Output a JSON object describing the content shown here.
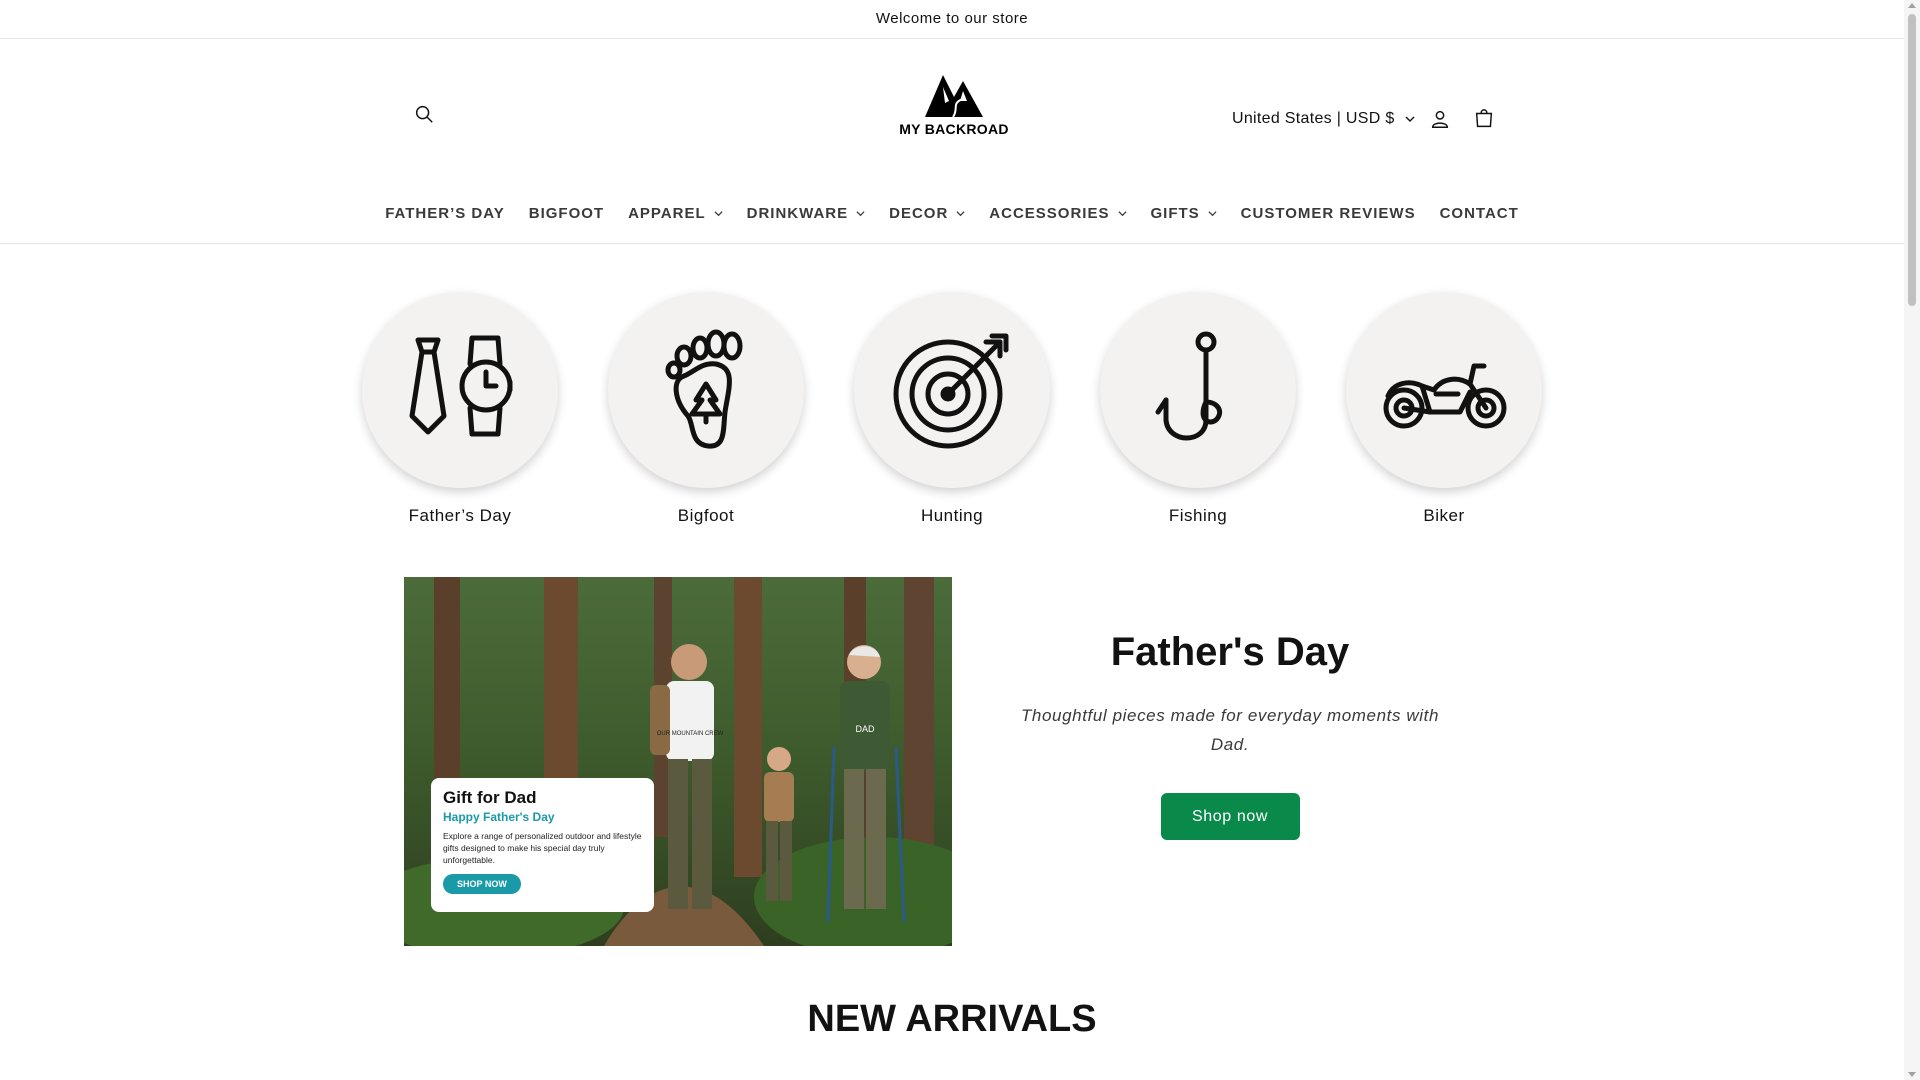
{
  "announcement": "Welcome to our store",
  "header": {
    "brand": "MY BACKROAD",
    "locale": "United States | USD $",
    "icons": {
      "search": "search-icon",
      "account": "account-icon",
      "cart": "cart-icon"
    }
  },
  "nav": [
    {
      "label": "FATHER’S DAY",
      "dropdown": false
    },
    {
      "label": "BIGFOOT",
      "dropdown": false
    },
    {
      "label": "APPAREL",
      "dropdown": true
    },
    {
      "label": "DRINKWARE",
      "dropdown": true
    },
    {
      "label": "DECOR",
      "dropdown": true
    },
    {
      "label": "ACCESSORIES",
      "dropdown": true
    },
    {
      "label": "GIFTS",
      "dropdown": true
    },
    {
      "label": "CUSTOMER REVIEWS",
      "dropdown": false
    },
    {
      "label": "CONTACT",
      "dropdown": false
    }
  ],
  "categories": [
    {
      "label": "Father’s Day",
      "icon": "tie-watch-icon"
    },
    {
      "label": "Bigfoot",
      "icon": "footprint-icon"
    },
    {
      "label": "Hunting",
      "icon": "target-icon"
    },
    {
      "label": "Fishing",
      "icon": "fishhook-icon"
    },
    {
      "label": "Biker",
      "icon": "motorcycle-icon"
    }
  ],
  "feature": {
    "title": "Father's Day",
    "description": "Thoughtful pieces made for everyday moments with Dad.",
    "button": "Shop now",
    "image_card": {
      "title": "Gift for Dad",
      "subtitle": "Happy Father's Day",
      "body": "Explore a range of personalized outdoor and lifestyle gifts designed to make his special day truly unforgettable.",
      "button": "SHOP NOW",
      "shirt_text": "OUR MOUNTAIN CREW",
      "vest_text": "DAD"
    }
  },
  "section_heading": "NEW ARRIVALS",
  "colors": {
    "accent": "#0a8a4a",
    "card_accent": "#1a9aa8"
  }
}
